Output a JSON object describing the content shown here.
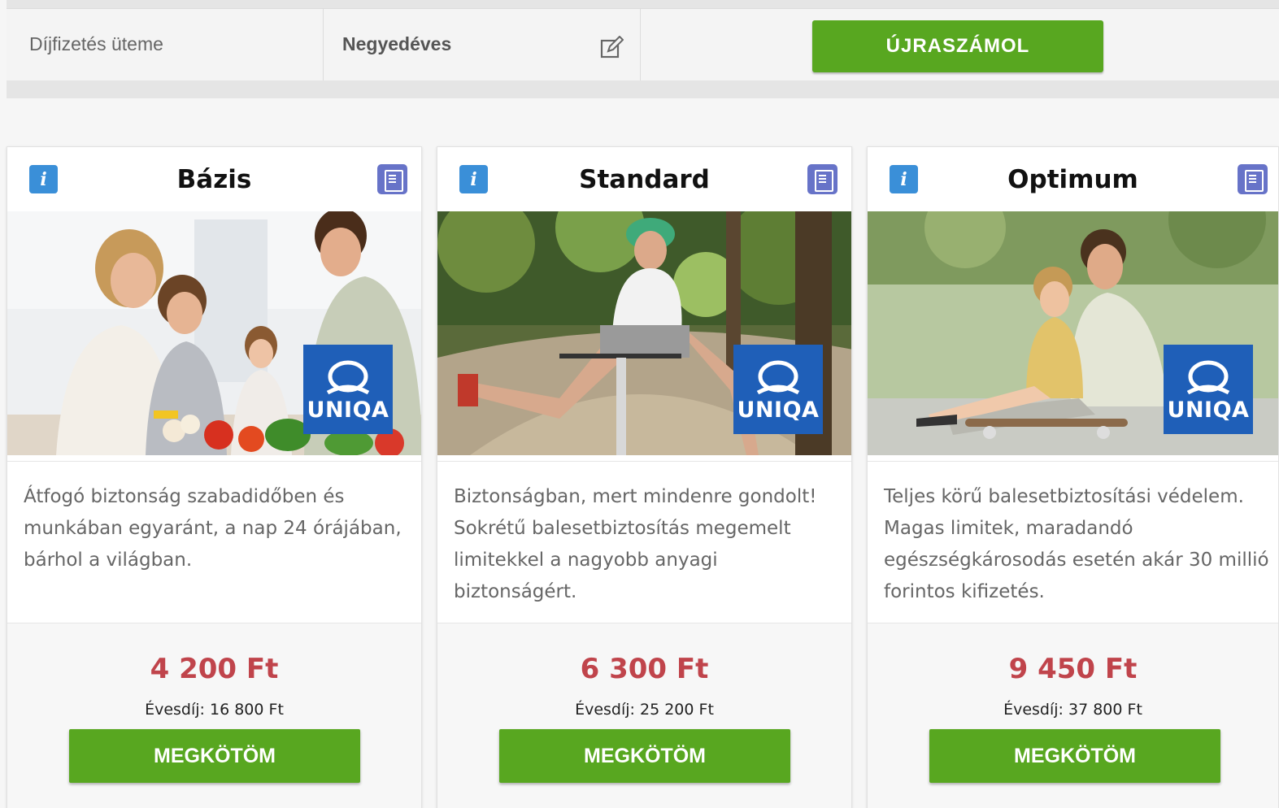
{
  "settings": {
    "payment_label": "Díjfizetés üteme",
    "payment_value": "Negyedéves",
    "recalc_label": "ÚJRASZÁMOL"
  },
  "colors": {
    "accent_green": "#58a720",
    "price_red": "#c0444b",
    "info_blue": "#3a8fd8",
    "doc_purple": "#6773c8",
    "uniqa_blue": "#1f5fb8"
  },
  "icons": [
    "edit-icon",
    "info-icon",
    "document-icon"
  ],
  "logo_text": "UNIQA",
  "plans": [
    {
      "title": "Bázis",
      "description": "Átfogó biztonság szabadidőben és munkában egyaránt, a nap 24 órájában, bárhol a világban.",
      "price": "4 200 Ft",
      "annual": "Évesdíj: 16 800 Ft",
      "button": "MEGKÖTÖM"
    },
    {
      "title": "Standard",
      "description": "Biztonságban, mert mindenre gondolt! Sokrétű balesetbiztosítás megemelt limitekkel a nagyobb anyagi biztonságért.",
      "price": "6 300 Ft",
      "annual": "Évesdíj: 25 200 Ft",
      "button": "MEGKÖTÖM"
    },
    {
      "title": "Optimum",
      "description": "Teljes körű balesetbiztosítási védelem. Magas limitek, maradandó egészségkárosodás esetén akár 30 millió forintos kifizetés.",
      "price": "9 450 Ft",
      "annual": "Évesdíj: 37 800 Ft",
      "button": "MEGKÖTÖM"
    }
  ]
}
